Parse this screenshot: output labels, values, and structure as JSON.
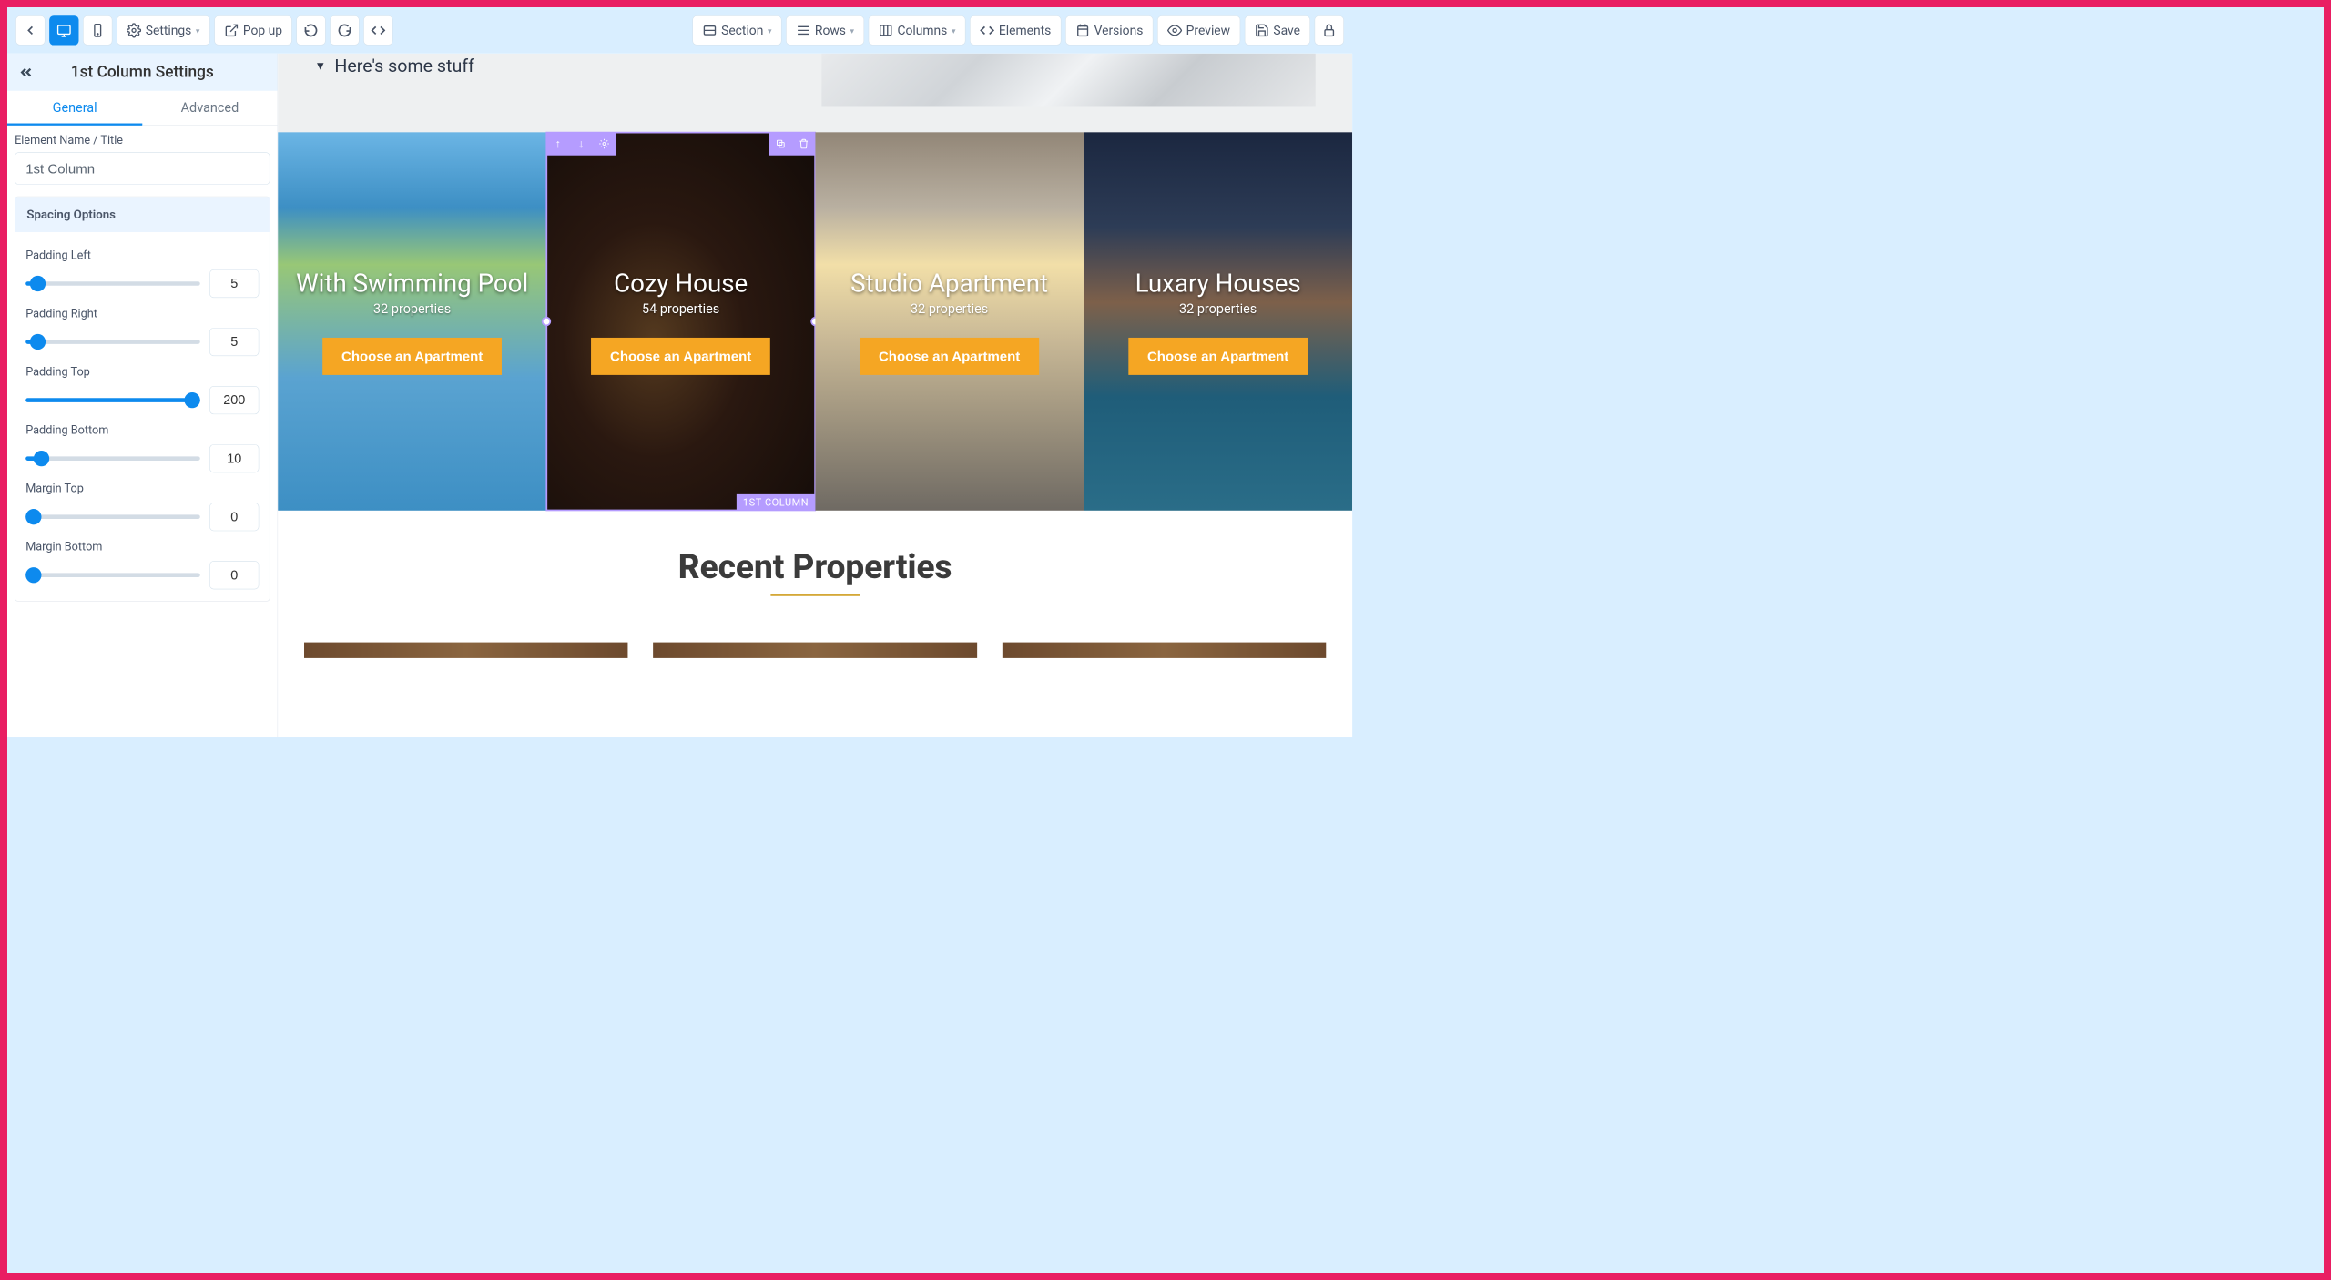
{
  "toolbar": {
    "settings": "Settings",
    "popup": "Pop up",
    "section": "Section",
    "rows": "Rows",
    "columns": "Columns",
    "elements": "Elements",
    "versions": "Versions",
    "preview": "Preview",
    "save": "Save"
  },
  "sidebar": {
    "title": "1st Column Settings",
    "tabs": {
      "general": "General",
      "advanced": "Advanced"
    },
    "element_name_label": "Element Name / Title",
    "element_name_value": "1st Column",
    "spacing_header": "Spacing Options",
    "sliders": [
      {
        "label": "Padding Left",
        "value": "5",
        "fill": 3
      },
      {
        "label": "Padding Right",
        "value": "5",
        "fill": 3
      },
      {
        "label": "Padding Top",
        "value": "200",
        "fill": 100
      },
      {
        "label": "Padding Bottom",
        "value": "10",
        "fill": 6
      },
      {
        "label": "Margin Top",
        "value": "0",
        "fill": 0
      },
      {
        "label": "Margin Bottom",
        "value": "0",
        "fill": 0
      }
    ]
  },
  "canvas": {
    "hero_text": "Here's some stuff",
    "cards": [
      {
        "title": "With Swimming Pool",
        "sub": "32 properties",
        "btn": "Choose an Apartment"
      },
      {
        "title": "Cozy House",
        "sub": "54 properties",
        "btn": "Choose an Apartment"
      },
      {
        "title": "Studio Apartment",
        "sub": "32 properties",
        "btn": "Choose an Apartment"
      },
      {
        "title": "Luxary Houses",
        "sub": "32 properties",
        "btn": "Choose an Apartment"
      }
    ],
    "selected_column_label": "1ST COLUMN",
    "recent_title": "Recent Properties"
  }
}
